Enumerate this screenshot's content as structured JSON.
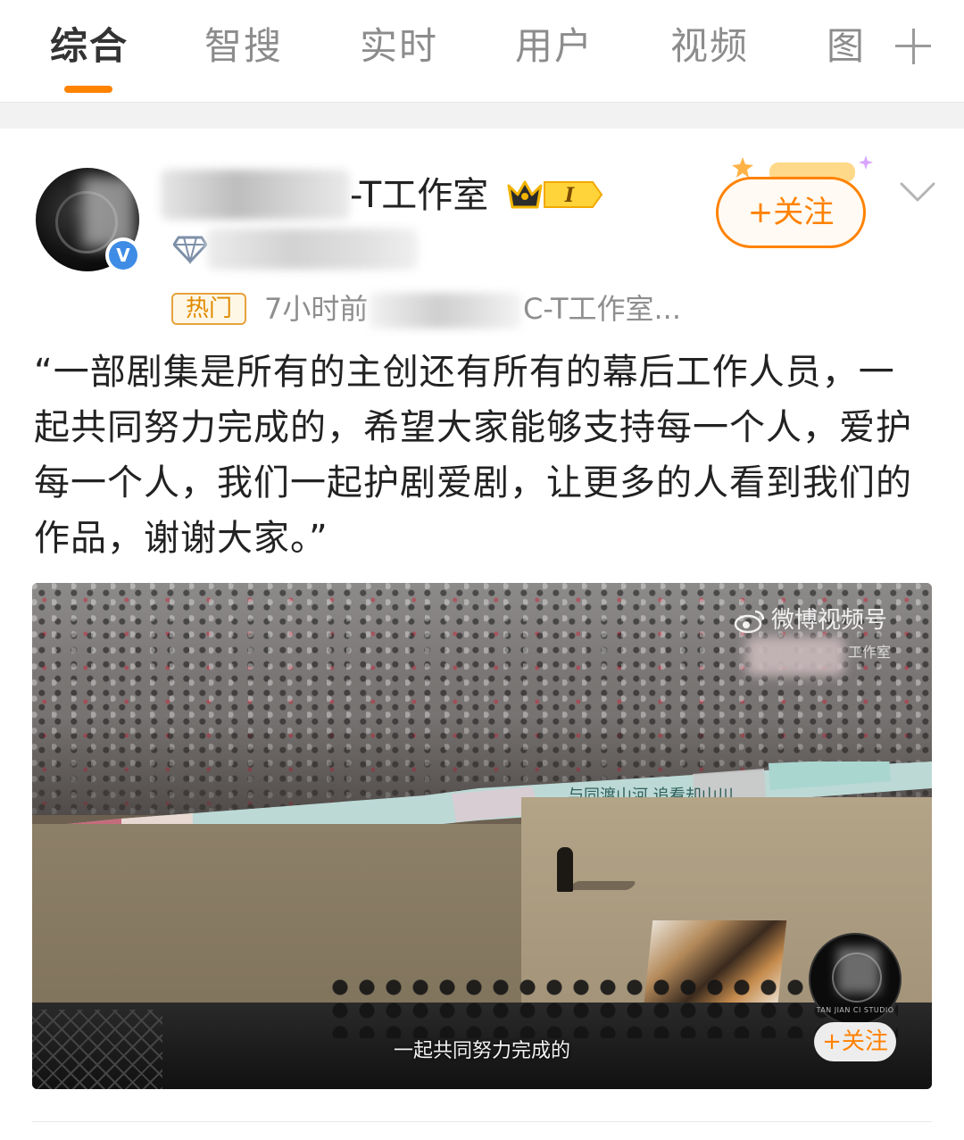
{
  "tabs": [
    {
      "label": "综合",
      "active": true
    },
    {
      "label": "智搜",
      "active": false
    },
    {
      "label": "实时",
      "active": false
    },
    {
      "label": "用户",
      "active": false
    },
    {
      "label": "视频",
      "active": false
    },
    {
      "label": "图",
      "active": false
    }
  ],
  "tab_add_icon": "plus-icon",
  "colors": {
    "accent": "#ff8200",
    "verified": "#3e8ce6",
    "muted_text": "#8e8e8e"
  },
  "post": {
    "username_suffix": "-T工作室",
    "badge_level_text": "I",
    "follow_label": "+关注",
    "meta": {
      "hot_tag": "热门",
      "time": "7小时前",
      "source_suffix": "C-T工作室..."
    },
    "text": "“一部剧集是所有的主创还有所有的幕后工作人员，一起共同努力完成的，希望大家能够支持每一个人，爱护每一个人，我们一起护剧爱剧，让更多的人看到我们的作品，谢谢大家。”",
    "media": {
      "watermark": "微博视频号",
      "watermark_sub": "工作室",
      "banner_text": "与同渡山河 追看却山川",
      "caption": "一起共同努力完成的",
      "channel_studio": "TAN JIAN CI STUDIO",
      "follow_label": "+关注"
    }
  }
}
